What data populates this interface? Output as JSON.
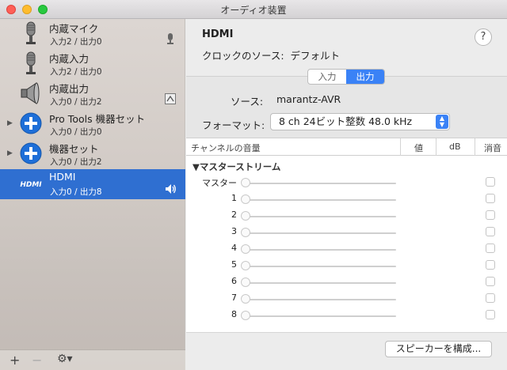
{
  "window": {
    "title": "オーディオ装置"
  },
  "sidebar": {
    "devices": [
      {
        "name": "内蔵マイク",
        "io": "入力2 / 出力0",
        "icon": "microphone-icon",
        "right_icon": "mic-small-icon"
      },
      {
        "name": "内蔵入力",
        "io": "入力2 / 出力0",
        "icon": "microphone-icon"
      },
      {
        "name": "内蔵出力",
        "io": "入力0 / 出力2",
        "icon": "speaker-icon",
        "right_icon": "output-port-icon"
      },
      {
        "name": "Pro Tools 機器セット",
        "io": "入力0 / 出力0",
        "icon": "plus-circle-icon",
        "disclosure": true
      },
      {
        "name": "機器セット",
        "io": "入力0 / 出力2",
        "icon": "plus-circle-icon",
        "disclosure": true
      },
      {
        "name": "HDMI",
        "io": "入力0 / 出力8",
        "icon": "hdmi-logo-icon",
        "right_icon": "volume-icon",
        "selected": true
      }
    ],
    "add_label": "+",
    "remove_label": "−",
    "gear_label": "⚙▾"
  },
  "main": {
    "device_title": "HDMI",
    "clock_label": "クロックのソース:",
    "clock_value": "デフォルト",
    "help_label": "?",
    "tabs": [
      "入力",
      "出力"
    ],
    "active_tab": "出力",
    "source_label": "ソース:",
    "source_value": "marantz-AVR",
    "format_label": "フォーマット:",
    "format_value": "8 ch 24ビット整数 48.0 kHz",
    "table": {
      "columns": [
        "チャンネルの音量",
        "値",
        "dB",
        "消音"
      ],
      "group": "▼マスターストリーム",
      "rows": [
        "マスター",
        "1",
        "2",
        "3",
        "4",
        "5",
        "6",
        "7",
        "8"
      ]
    },
    "configure_speakers_label": "スピーカーを構成..."
  },
  "colors": {
    "selection": "#2f6fd1",
    "accent": "#3a82f6"
  }
}
